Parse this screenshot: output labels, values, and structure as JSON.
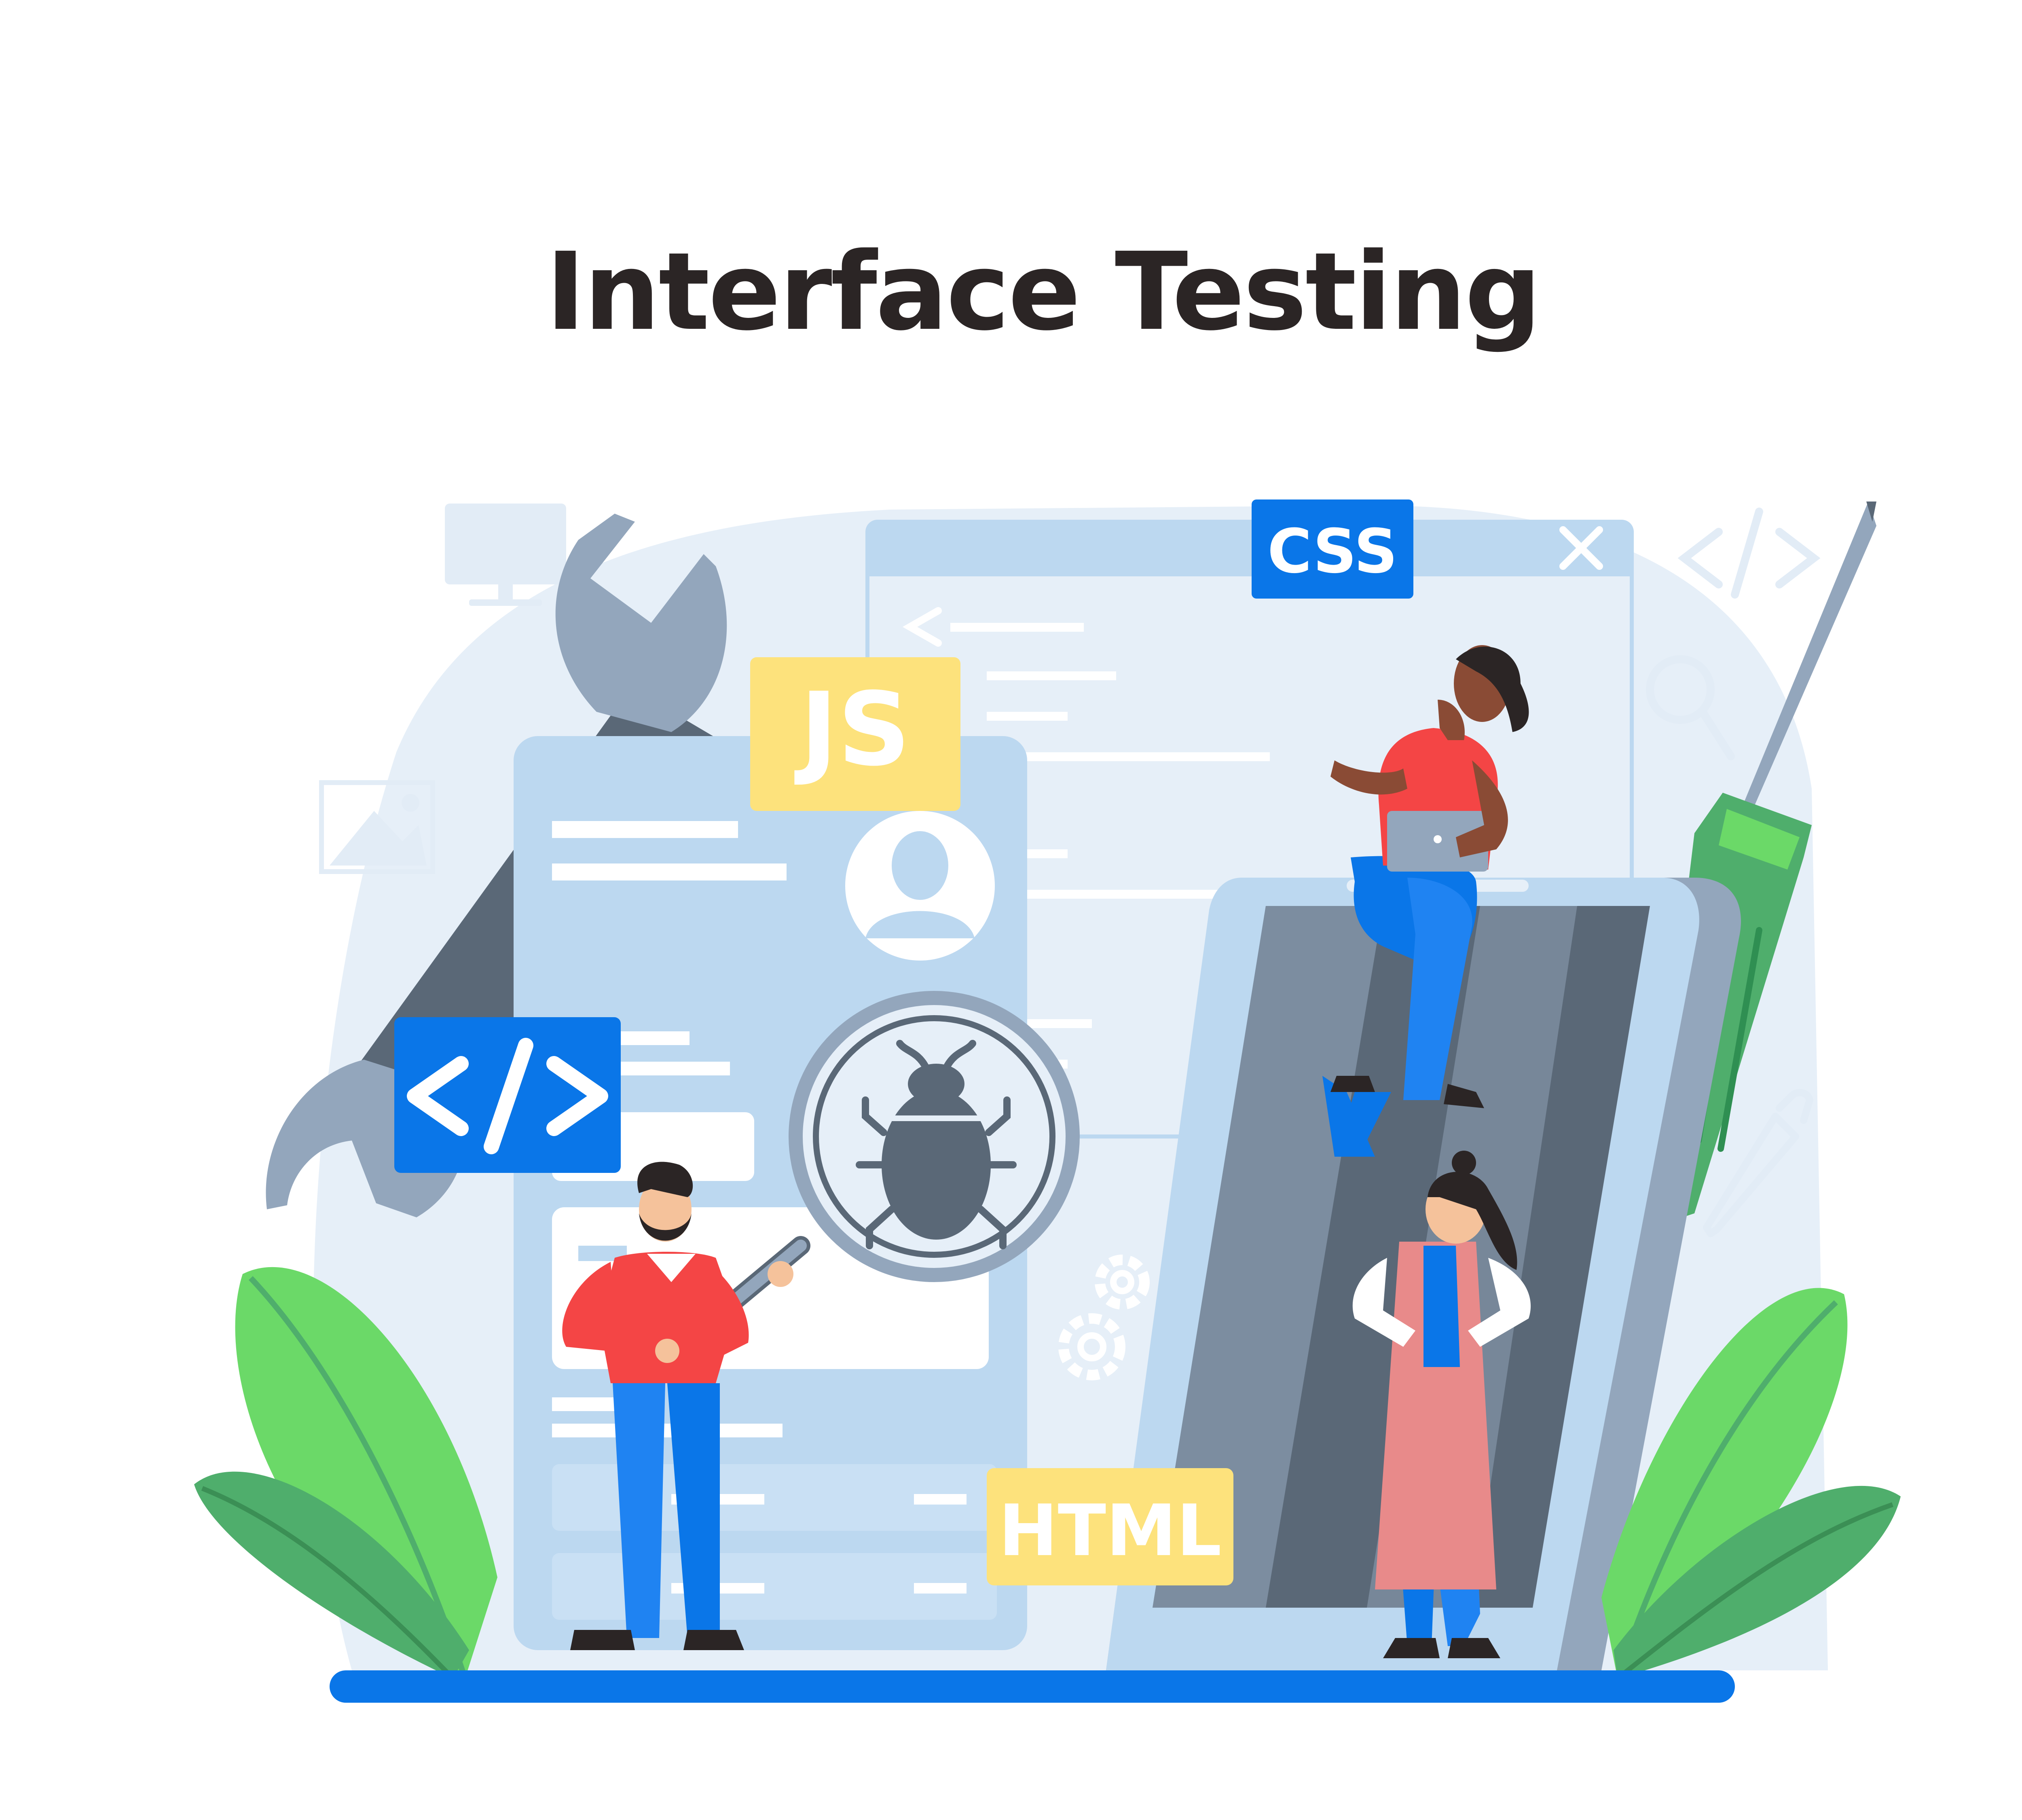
{
  "title": "Interface Testing",
  "tags": {
    "js": "JS",
    "css": "CSS",
    "html": "HTML"
  },
  "icons": {
    "code": "code-brackets-icon",
    "bug": "bug-icon",
    "user": "user-avatar-icon",
    "close": "close-icon",
    "search": "magnifier-icon",
    "image": "image-icon",
    "monitor": "monitor-icon",
    "gears": "gear-icon",
    "dropper": "eyedropper-icon"
  },
  "colors": {
    "accent_blue": "#0a76e8",
    "panel_blue": "#bcd8f0",
    "pale_blue": "#e6eff8",
    "js_yellow": "#fde27c",
    "leaf_green": "#6bd968",
    "leaf_dark_green": "#4fae6c",
    "shirt_red": "#f44545",
    "tool_grey": "#93a6bc",
    "phone_slate": "#5a6877"
  }
}
